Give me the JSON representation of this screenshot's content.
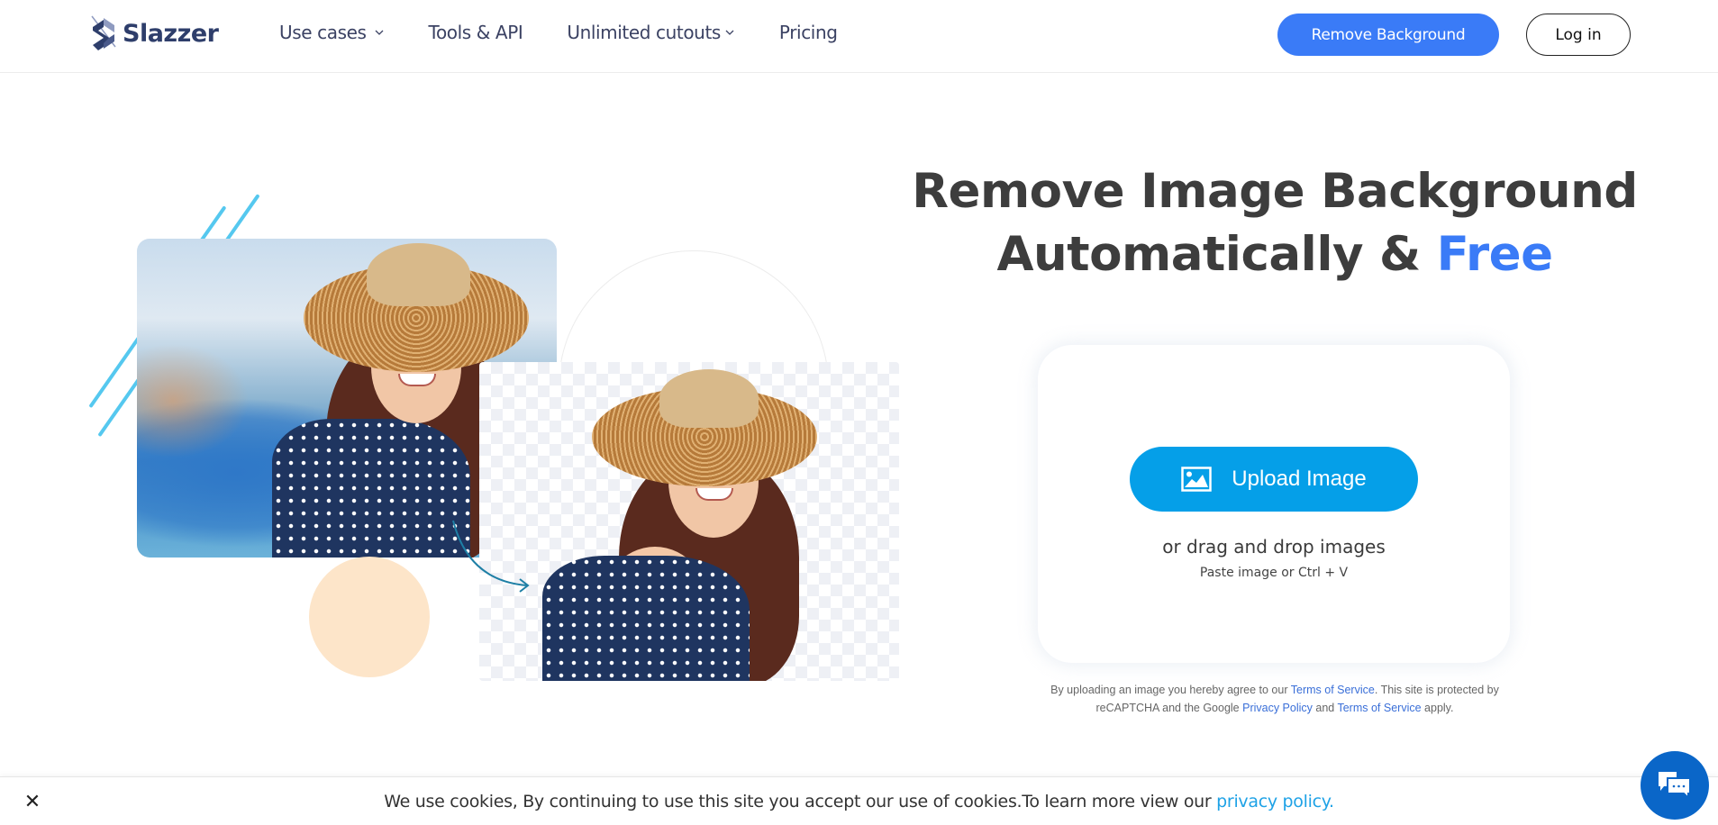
{
  "brand": {
    "name": "Slazzer",
    "primary_color": "#3a7bf7",
    "upload_color": "#059fe8",
    "logo_color": "#2e3e6b"
  },
  "header": {
    "nav": [
      {
        "label": "Use cases",
        "has_dropdown": true
      },
      {
        "label": "Tools & API",
        "has_dropdown": false
      },
      {
        "label": "Unlimited cutouts",
        "has_dropdown": true
      },
      {
        "label": "Pricing",
        "has_dropdown": false
      }
    ],
    "remove_bg_label": "Remove Background",
    "login_label": "Log in"
  },
  "hero": {
    "title_line1": "Remove Image Background",
    "title_line2_prefix": "Automatically & ",
    "title_line2_accent": "Free",
    "illustration": {
      "before_image": "woman-in-straw-hat-with-background",
      "after_image": "woman-in-straw-hat-transparent-background"
    }
  },
  "upload": {
    "button_label": "Upload Image",
    "icon": "image-icon",
    "drag_text": "or drag and drop images",
    "paste_text": "Paste image or Ctrl + V"
  },
  "legal": {
    "part1": "By uploading an image you hereby agree to our ",
    "terms_link": "Terms of Service",
    "part2": ". This site is protected by reCAPTCHA and the Google ",
    "privacy_link": "Privacy Policy",
    "part3": " and ",
    "terms_link2": "Terms of Service",
    "part4": " apply."
  },
  "cookie": {
    "close_icon": "close-icon",
    "text": "We use cookies, By continuing to use this site you accept our use of cookies.To learn more view our ",
    "link": "privacy policy."
  },
  "chat": {
    "icon": "chat-bubbles-icon"
  }
}
